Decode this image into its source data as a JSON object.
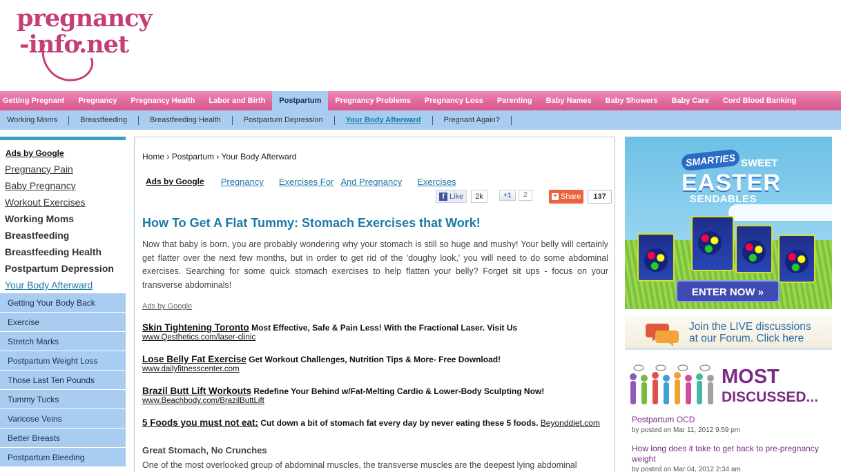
{
  "logo": {
    "line1": "pregnancy",
    "line2": "-info.net"
  },
  "topnav": [
    {
      "label": "Getting Pregnant",
      "active": false
    },
    {
      "label": "Pregnancy",
      "active": false
    },
    {
      "label": "Pregnancy Health",
      "active": false
    },
    {
      "label": "Labor and Birth",
      "active": false
    },
    {
      "label": "Postpartum",
      "active": true
    },
    {
      "label": "Pregnancy Problems",
      "active": false
    },
    {
      "label": "Pregnancy Loss",
      "active": false
    },
    {
      "label": "Parenting",
      "active": false
    },
    {
      "label": "Baby Names",
      "active": false
    },
    {
      "label": "Baby Showers",
      "active": false
    },
    {
      "label": "Baby Care",
      "active": false
    },
    {
      "label": "Cord Blood Banking",
      "active": false
    }
  ],
  "subnav": [
    {
      "label": "Working Moms",
      "active": false
    },
    {
      "label": "Breastfeeding",
      "active": false
    },
    {
      "label": "Breastfeeding Health",
      "active": false
    },
    {
      "label": "Postpartum Depression",
      "active": false
    },
    {
      "label": "Your Body Afterward",
      "active": true
    },
    {
      "label": "Pregnant Again?",
      "active": false
    }
  ],
  "sidebar": {
    "ads_label": "Ads by Google",
    "ads": [
      "Pregnancy Pain",
      "Baby Pregnancy",
      "Workout Exercises"
    ],
    "nav": [
      "Working Moms",
      "Breastfeeding",
      "Breastfeeding Health",
      "Postpartum Depression"
    ],
    "current": "Your Body Afterward",
    "sub": [
      "Getting Your Body Back",
      "Exercise",
      "Stretch Marks",
      "Postpartum Weight Loss",
      "Those Last Ten Pounds",
      "Tummy Tucks",
      "Varicose Veins",
      "Better Breasts",
      "Postpartum Bleeding"
    ]
  },
  "breadcrumb": [
    "Home",
    "Postpartum",
    "Your Body Afterward"
  ],
  "ads_row": {
    "label": "Ads by Google",
    "links": [
      "Pregnancy",
      "Exercises For",
      "And Pregnancy",
      "Exercises"
    ]
  },
  "social": {
    "fb_like": "Like",
    "fb_count": "2k",
    "gplus": "+1",
    "gplus_count": "2",
    "share": "Share",
    "share_count": "137"
  },
  "article": {
    "title": "How To Get A Flat Tummy: Stomach Exercises that Work!",
    "intro": "Now that baby is born, you are probably wondering why your stomach is still so huge and mushy! Your belly will certainly get flatter over the next few months, but in order to get rid of the 'doughy look,' you will need to do some abdominal exercises. Searching for some quick stomach exercises to help flatten your belly? Forget sit ups - focus on your transverse abdominals!",
    "ads_label": "Ads by Google",
    "ads": [
      {
        "title": "Skin Tightening Toronto",
        "desc": "Most Effective, Safe & Pain Less! With the Fractional Laser. Visit Us",
        "url": "www.Qesthetics.com/laser-clinic"
      },
      {
        "title": "Lose Belly Fat Exercise",
        "desc": "Get Workout Challenges, Nutrition Tips & More- Free Download!",
        "url": "www.dailyfitnesscenter.com"
      },
      {
        "title": "Brazil Butt Lift Workouts",
        "desc": "Redefine Your Behind w/Fat-Melting Cardio & Lower-Body Sculpting Now!",
        "url": "www.Beachbody.com/BrazilButtLift"
      },
      {
        "title": "5 Foods you must not eat:",
        "desc": "Cut down a bit of stomach fat every day by never eating these 5 foods.",
        "url": "Beyonddiet.com"
      }
    ],
    "section_heading": "Great Stomach, No Crunches",
    "section_text": "One of the most overlooked group of abdominal muscles, the transverse muscles are the deepest lying abdominal"
  },
  "right": {
    "banner": {
      "brand": "SMARTIES",
      "sweet": "SWEET",
      "line1": "EASTER",
      "line2": "SENDABLES",
      "pack_label": "SMARTIES",
      "cta": "ENTER NOW"
    },
    "forum": {
      "line1": "Join the LIVE discussions",
      "line2": "at our Forum. Click here"
    },
    "most_discussed": {
      "line1": "MOST",
      "line2": "DISCUSSED..."
    },
    "posts": [
      {
        "title": "Postpartum OCD",
        "meta": "by posted on Mar 11, 2012 9:59 pm"
      },
      {
        "title": "How long does it take to get back to pre-pregnancy weight",
        "meta": "by posted on Mar 04, 2012 2:34 am"
      }
    ]
  }
}
